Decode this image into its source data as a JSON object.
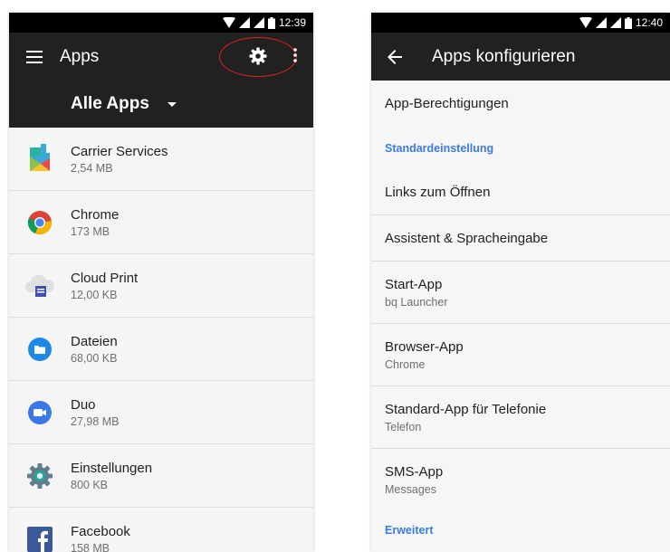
{
  "left_screen": {
    "status_time": "12:39",
    "toolbar_title": "Apps",
    "filter_label": "Alle Apps",
    "apps": [
      {
        "name": "Carrier Services",
        "size": "2,54 MB",
        "icon": "carrier-services-icon"
      },
      {
        "name": "Chrome",
        "size": "173 MB",
        "icon": "chrome-icon"
      },
      {
        "name": "Cloud Print",
        "size": "12,00 KB",
        "icon": "cloud-print-icon"
      },
      {
        "name": "Dateien",
        "size": "68,00 KB",
        "icon": "files-icon"
      },
      {
        "name": "Duo",
        "size": "27,98 MB",
        "icon": "duo-icon"
      },
      {
        "name": "Einstellungen",
        "size": "800 KB",
        "icon": "settings-app-icon"
      },
      {
        "name": "Facebook",
        "size": "158 MB",
        "icon": "facebook-icon"
      }
    ]
  },
  "right_screen": {
    "status_time": "12:40",
    "toolbar_title": "Apps konfigurieren",
    "app_permissions": "App-Berechtigungen",
    "section_default": "Standardeinstellung",
    "links": "Links zum Öffnen",
    "assistant": "Assistent & Spracheingabe",
    "home_app": {
      "title": "Start-App",
      "value": "bq Launcher"
    },
    "browser_app": {
      "title": "Browser-App",
      "value": "Chrome"
    },
    "phone_app": {
      "title": "Standard-App für Telefonie",
      "value": "Telefon"
    },
    "sms_app": {
      "title": "SMS-App",
      "value": "Messages"
    },
    "section_advanced": "Erweitert"
  },
  "colors": {
    "toolbar": "#212121",
    "status_bar": "#000000",
    "accent": "#3a7de0",
    "highlight_circle": "#e02020"
  }
}
